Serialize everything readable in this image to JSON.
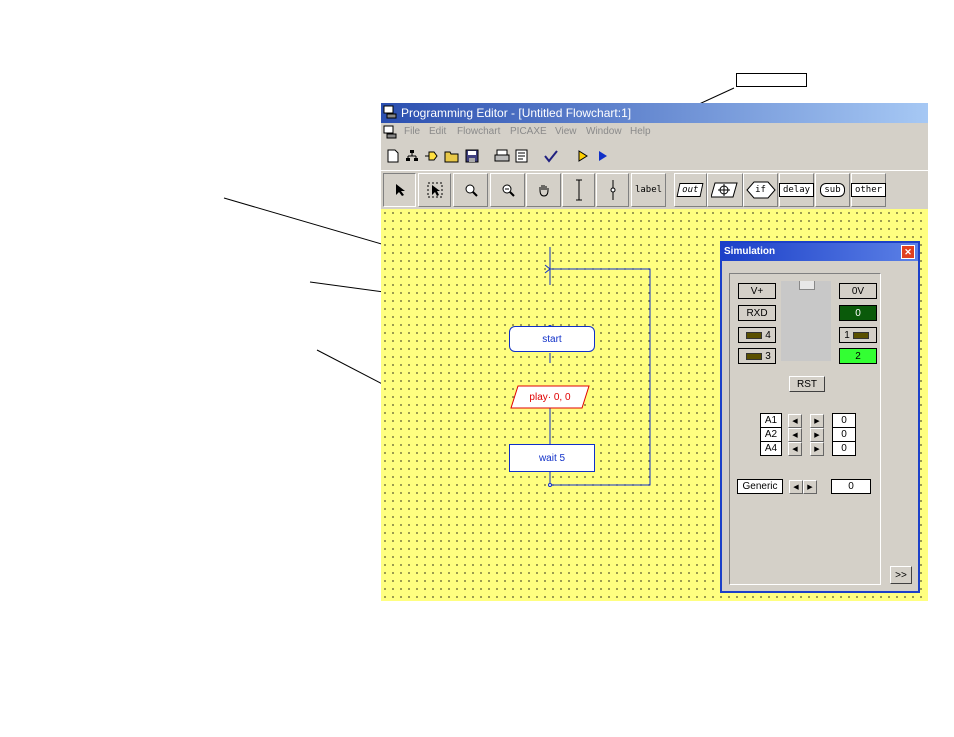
{
  "window": {
    "title": "Programming Editor  - [Untitled Flowchart:1]"
  },
  "menu": [
    "File",
    "Edit",
    "Flowchart",
    "PICAXE",
    "View",
    "Window",
    "Help"
  ],
  "toolbar1": {
    "icons": [
      "new-icon",
      "tree-icon",
      "plug-icon",
      "open-icon",
      "save-icon",
      "print-icon",
      "print-setup-icon",
      "check-icon",
      "simulate-icon",
      "run-icon"
    ]
  },
  "toolbar2": {
    "tools": [
      "select-icon",
      "select-area-icon",
      "zoom-in-icon",
      "zoom-icon",
      "pan-icon",
      "line-icon",
      "connector-icon"
    ],
    "label_tool": "label",
    "out_tool": "out",
    "if_tool": "if",
    "delay_tool": "delay",
    "sub_tool": "sub",
    "other_tool": "other"
  },
  "flowchart": {
    "start": "start",
    "play": "play· 0, 0",
    "wait": "wait 5"
  },
  "simulation": {
    "title": "Simulation",
    "vplus": "V+",
    "zerov": "0V",
    "rxd": "RXD",
    "pin4": "4",
    "pin3": "3",
    "out0": "0",
    "pin1": "1",
    "out2": "2",
    "rst": "RST",
    "analog": [
      {
        "label": "A1",
        "value": "0"
      },
      {
        "label": "A2",
        "value": "0"
      },
      {
        "label": "A4",
        "value": "0"
      }
    ],
    "generic_label": "Generic",
    "generic_value": "0",
    "expand": ">>"
  },
  "colors": {
    "canvas": "#ffff80",
    "sim_border": "#1c40c8",
    "output_green_on": "#33ff33",
    "output_green_off": "#0a5a0a",
    "flow_text": "#1030c8",
    "play_text": "#e00000"
  }
}
